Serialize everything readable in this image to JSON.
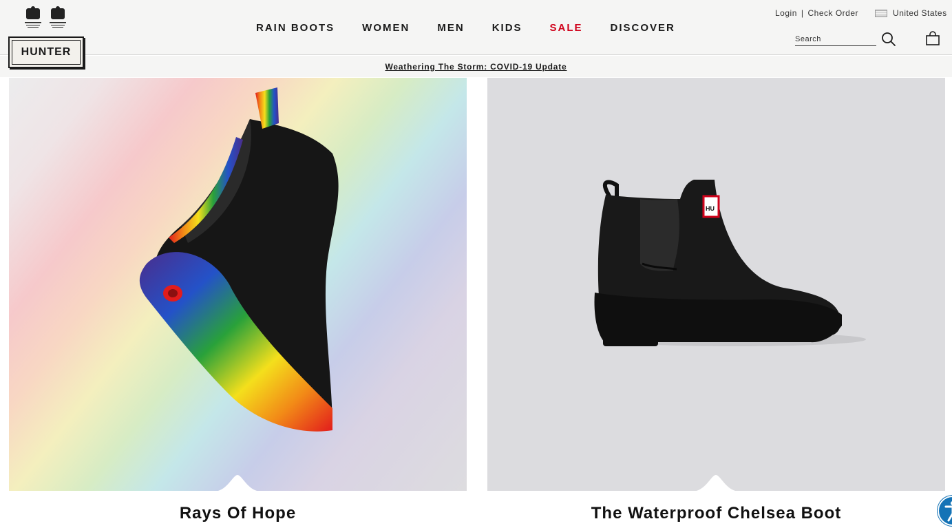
{
  "brand": {
    "logo_text": "HUNTER",
    "crests_icon": "royal-warrant-crests"
  },
  "nav": {
    "items": [
      {
        "label": "RAIN BOOTS"
      },
      {
        "label": "WOMEN"
      },
      {
        "label": "MEN"
      },
      {
        "label": "KIDS"
      },
      {
        "label": "SALE"
      },
      {
        "label": "DISCOVER"
      }
    ],
    "sale_color": "#d0021b"
  },
  "utility": {
    "login": "Login",
    "separator": "|",
    "check_order": "Check Order",
    "country": "United States",
    "flag_icon": "us-flag-icon"
  },
  "search": {
    "placeholder": "Search",
    "icon": "search-icon"
  },
  "cart": {
    "icon": "shopping-bag-icon"
  },
  "notice": {
    "text": "Weathering The Storm: COVID-19 Update"
  },
  "products": [
    {
      "title": "Rays Of Hope",
      "image": "rainbow-chelsea-boot"
    },
    {
      "title": "The Waterproof Chelsea Boot",
      "image": "black-chelsea-boot"
    }
  ],
  "accessibility": {
    "icon": "accessibility-icon",
    "color": "#1473b6"
  }
}
